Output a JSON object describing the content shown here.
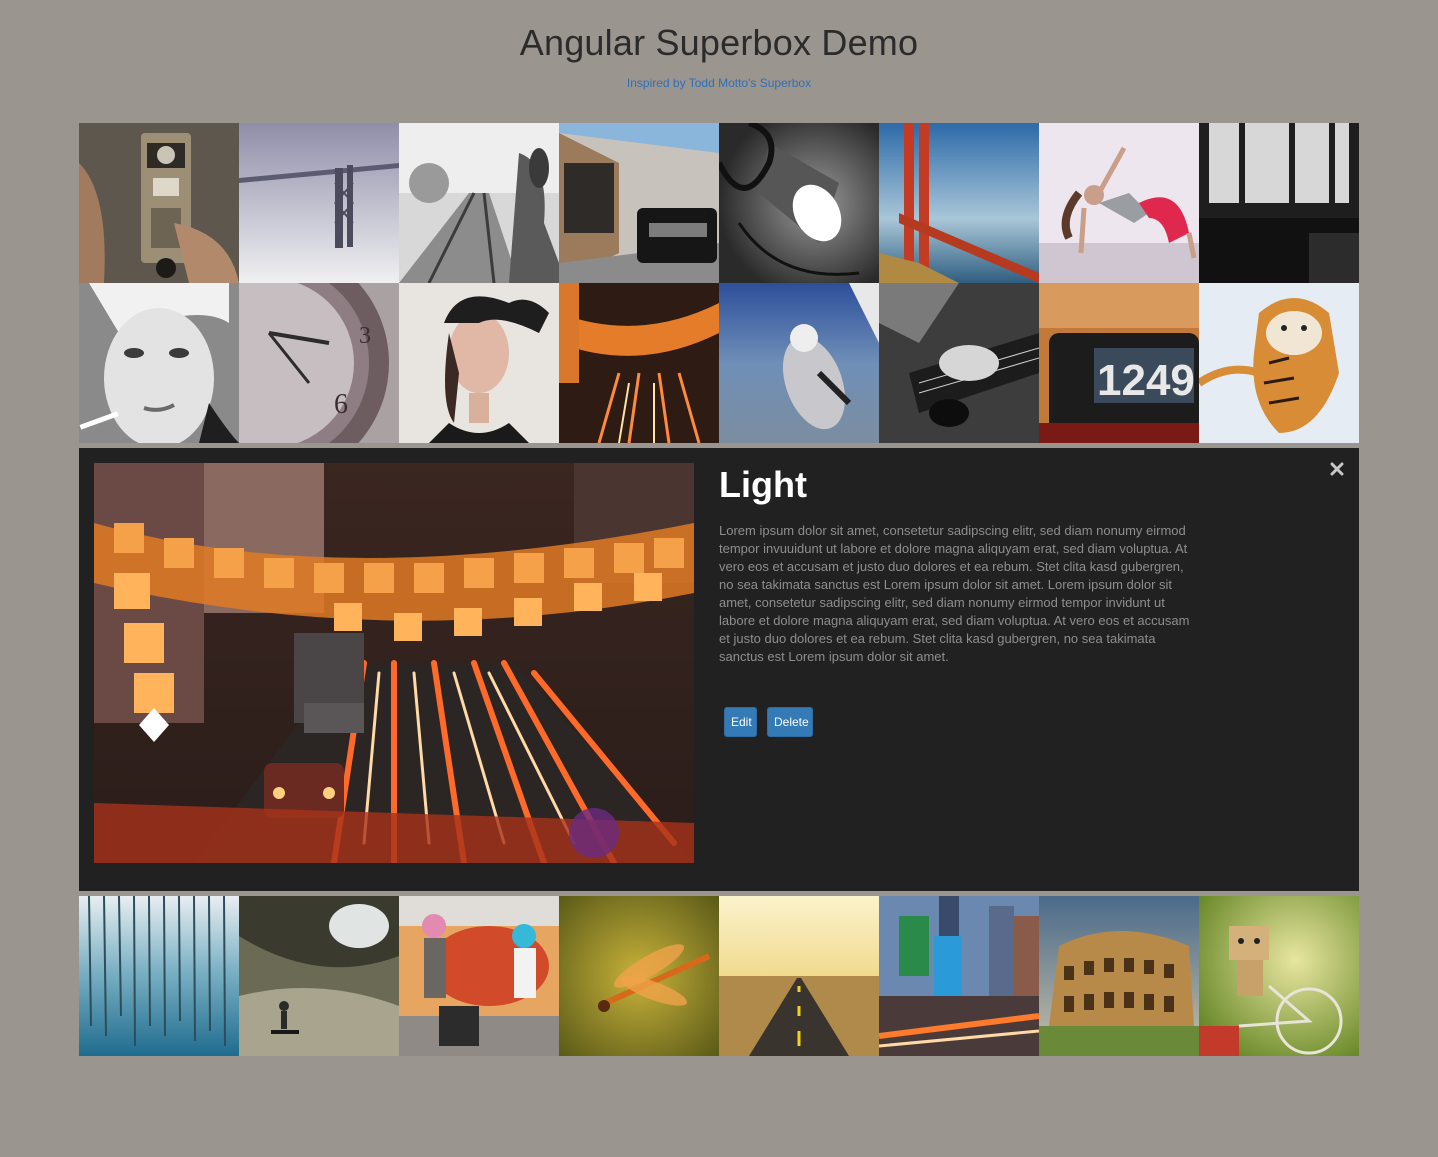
{
  "header": {
    "title": "Angular Superbox Demo",
    "subtitle_link": "Inspired by Todd Motto's Superbox"
  },
  "gallery": {
    "row1": [
      {
        "image": "vintage-camera-photo"
      },
      {
        "image": "foggy-bridge-photo"
      },
      {
        "image": "railroad-tracks-photo"
      },
      {
        "image": "range-rover-photo"
      },
      {
        "image": "desk-lamp-photo"
      },
      {
        "image": "golden-gate-bridge-photo"
      },
      {
        "image": "dancer-photo"
      },
      {
        "image": "cafe-chairs-photo"
      }
    ],
    "row2": [
      {
        "image": "woman-smoking-photo"
      },
      {
        "image": "clock-photo"
      },
      {
        "image": "woman-with-hat-photo"
      },
      {
        "image": "city-lanterns-photo"
      },
      {
        "image": "skydiver-photo"
      },
      {
        "image": "guitar-player-photo"
      },
      {
        "image": "flip-clock-photo"
      },
      {
        "image": "tiger-photo"
      }
    ],
    "row3": [
      {
        "image": "blue-pond-photo"
      },
      {
        "image": "skateboarder-photo"
      },
      {
        "image": "colorful-kids-photo"
      },
      {
        "image": "dragonfly-photo"
      },
      {
        "image": "desert-road-photo"
      },
      {
        "image": "times-square-photo"
      },
      {
        "image": "colosseum-photo"
      },
      {
        "image": "danbo-bicycle-photo"
      }
    ]
  },
  "detail": {
    "title": "Light",
    "description": "Lorem ipsum dolor sit amet, consetetur sadipscing elitr, sed diam nonumy eirmod tempor invuuidunt ut labore et dolore magna aliquyam erat, sed diam voluptua. At vero eos et accusam et justo duo dolores et ea rebum. Stet clita kasd gubergren, no sea takimata sanctus est Lorem ipsum dolor sit amet. Lorem ipsum dolor sit amet, consetetur sadipscing elitr, sed diam nonumy eirmod tempor invidunt ut labore et dolore magna aliquyam erat, sed diam voluptua. At vero eos et accusam et justo duo dolores et ea rebum. Stet clita kasd gubergren, no sea takimata sanctus est Lorem ipsum dolor sit amet.",
    "edit_label": "Edit",
    "delete_label": "Delete",
    "close_icon": "close-icon",
    "image": "city-lanterns-photo-large"
  },
  "colors": {
    "background": "#9b9590",
    "panel": "#212121",
    "accent": "#337ab7",
    "link": "#2f6fb5"
  }
}
